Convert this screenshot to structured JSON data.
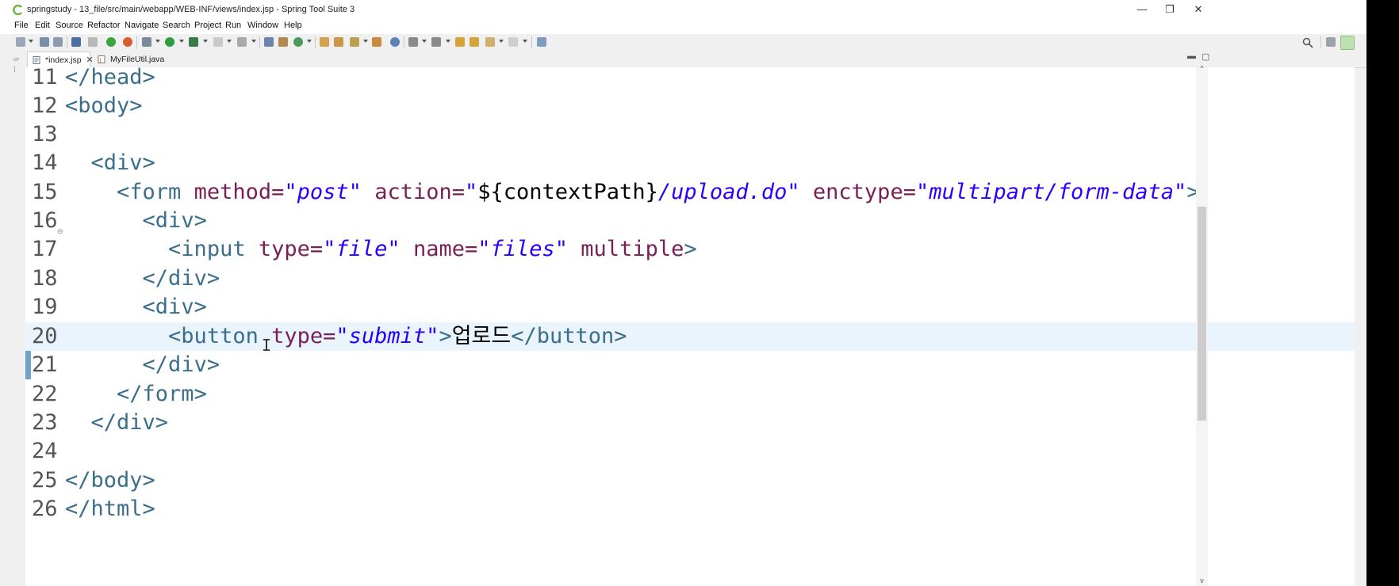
{
  "window": {
    "title": "springstudy - 13_file/src/main/webapp/WEB-INF/views/index.jsp - Spring Tool Suite 3",
    "minimize": "—",
    "maximize": "❐",
    "close": "✕"
  },
  "menu": [
    "File",
    "Edit",
    "Source",
    "Refactor",
    "Navigate",
    "Search",
    "Project",
    "Run",
    "Window",
    "Help"
  ],
  "tabs": [
    {
      "label": "*index.jsp",
      "close": "✕"
    },
    {
      "label": "MyFileUtil.java"
    }
  ],
  "editor": {
    "lines": [
      {
        "n": "11"
      },
      {
        "n": "12"
      },
      {
        "n": "13"
      },
      {
        "n": "14"
      },
      {
        "n": "15"
      },
      {
        "n": "16"
      },
      {
        "n": "17"
      },
      {
        "n": "18"
      },
      {
        "n": "19"
      },
      {
        "n": "20"
      },
      {
        "n": "21"
      },
      {
        "n": "22"
      },
      {
        "n": "23"
      },
      {
        "n": "24"
      },
      {
        "n": "25"
      },
      {
        "n": "26"
      }
    ],
    "code": {
      "l11": "</head>",
      "l12": "<body>",
      "l14": "<div>",
      "l15_tag": "<form",
      "l15_a1": "method=",
      "l15_v1": "\"post\"",
      "l15_a2": "action=",
      "l15_v2a": "\"",
      "l15_plain": "${contextPath}",
      "l15_v2b": "/upload.do\"",
      "l15_a3": "enctype=",
      "l15_v3": "\"multipart/form-data\"",
      "l15_end": ">",
      "l16": "<div>",
      "l17_tag": "<input",
      "l17_a1": "type=",
      "l17_v1": "\"file\"",
      "l17_a2": "name=",
      "l17_v2": "\"files\"",
      "l17_a3": "multiple",
      "l17_end": ">",
      "l18": "</div>",
      "l19": "<div>",
      "l20_tag": "<button",
      "l20_a1": "type=",
      "l20_v1": "\"submit\"",
      "l20_gt": ">",
      "l20_text": "업로드",
      "l20_close": "</button>",
      "l21": "</div>",
      "l22": "</form>",
      "l23": "</div>",
      "l25": "</body>",
      "l26": "</html>"
    }
  },
  "colors": {
    "tag": "#3a6e8a",
    "attribute": "#7a1f55",
    "value": "#2a00ff",
    "current_line": "#eaf4fd"
  }
}
